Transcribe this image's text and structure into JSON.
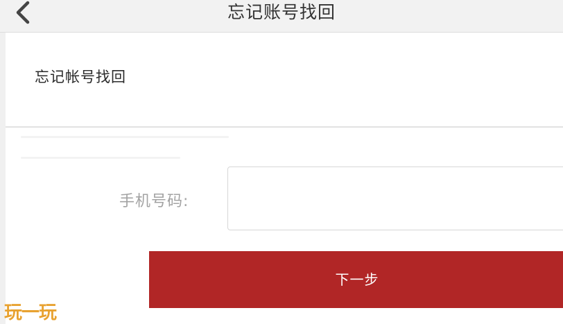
{
  "navbar": {
    "title": "忘记账号找回",
    "back_icon": "chevron-left-icon"
  },
  "section": {
    "title": "忘记帐号找回"
  },
  "form": {
    "phone_label": "手机号码:",
    "phone_value": "",
    "phone_placeholder": "",
    "next_button_label": "下一步"
  },
  "watermark": {
    "text": "玩一玩"
  },
  "colors": {
    "primary_button": "#b12626",
    "navbar_bg": "#f2f2f2",
    "watermark": "#e8a230"
  }
}
